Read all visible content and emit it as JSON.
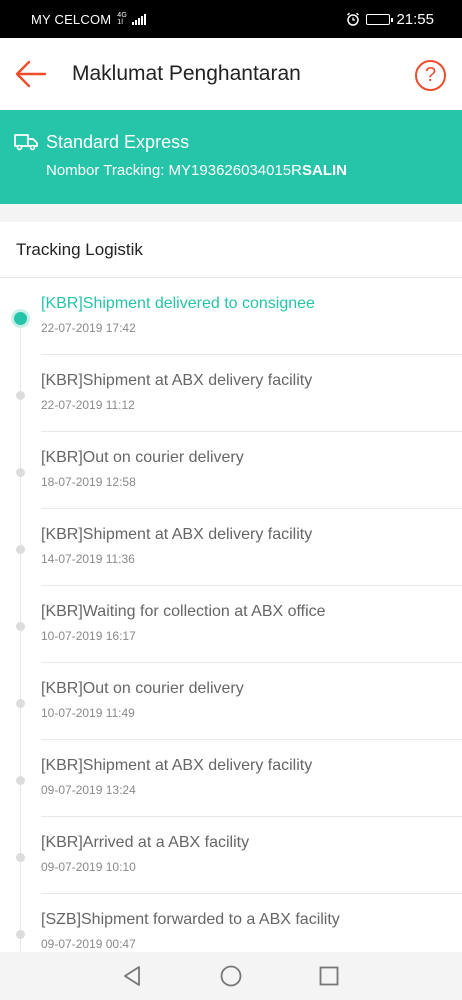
{
  "status_bar": {
    "carrier": "MY CELCOM",
    "network": "4G",
    "network_sub": "1l",
    "time": "21:55",
    "icons": [
      "signal-icon",
      "alarm-icon",
      "battery-icon"
    ]
  },
  "header": {
    "title": "Maklumat Penghantaran",
    "help_label": "?",
    "icons": [
      "back-arrow-icon",
      "help-icon"
    ]
  },
  "shipping": {
    "method": "Standard Express",
    "tracking_label": "Nombor Tracking: ",
    "tracking_number": "MY193626034015R",
    "copy_label": "SALIN",
    "icon": "truck-icon"
  },
  "logistics": {
    "title": "Tracking Logistik",
    "events": [
      {
        "description": "[KBR]Shipment delivered to consignee",
        "time": "22-07-2019 17:42",
        "active": true
      },
      {
        "description": "[KBR]Shipment at ABX delivery facility",
        "time": "22-07-2019 11:12",
        "active": false
      },
      {
        "description": "[KBR]Out on courier delivery",
        "time": "18-07-2019 12:58",
        "active": false
      },
      {
        "description": "[KBR]Shipment at ABX delivery facility",
        "time": "14-07-2019 11:36",
        "active": false
      },
      {
        "description": "[KBR]Waiting for collection at ABX office",
        "time": "10-07-2019 16:17",
        "active": false
      },
      {
        "description": "[KBR]Out on courier delivery",
        "time": "10-07-2019 11:49",
        "active": false
      },
      {
        "description": "[KBR]Shipment at ABX delivery facility",
        "time": "09-07-2019 13:24",
        "active": false
      },
      {
        "description": "[KBR]Arrived at a ABX facility",
        "time": "09-07-2019 10:10",
        "active": false
      },
      {
        "description": "[SZB]Shipment forwarded to a ABX facility",
        "time": "09-07-2019 00:47",
        "active": false
      }
    ]
  },
  "colors": {
    "accent": "#ee4d2d",
    "teal": "#26c4a8"
  },
  "nav_icons": [
    "back-triangle-icon",
    "home-circle-icon",
    "recents-square-icon"
  ]
}
